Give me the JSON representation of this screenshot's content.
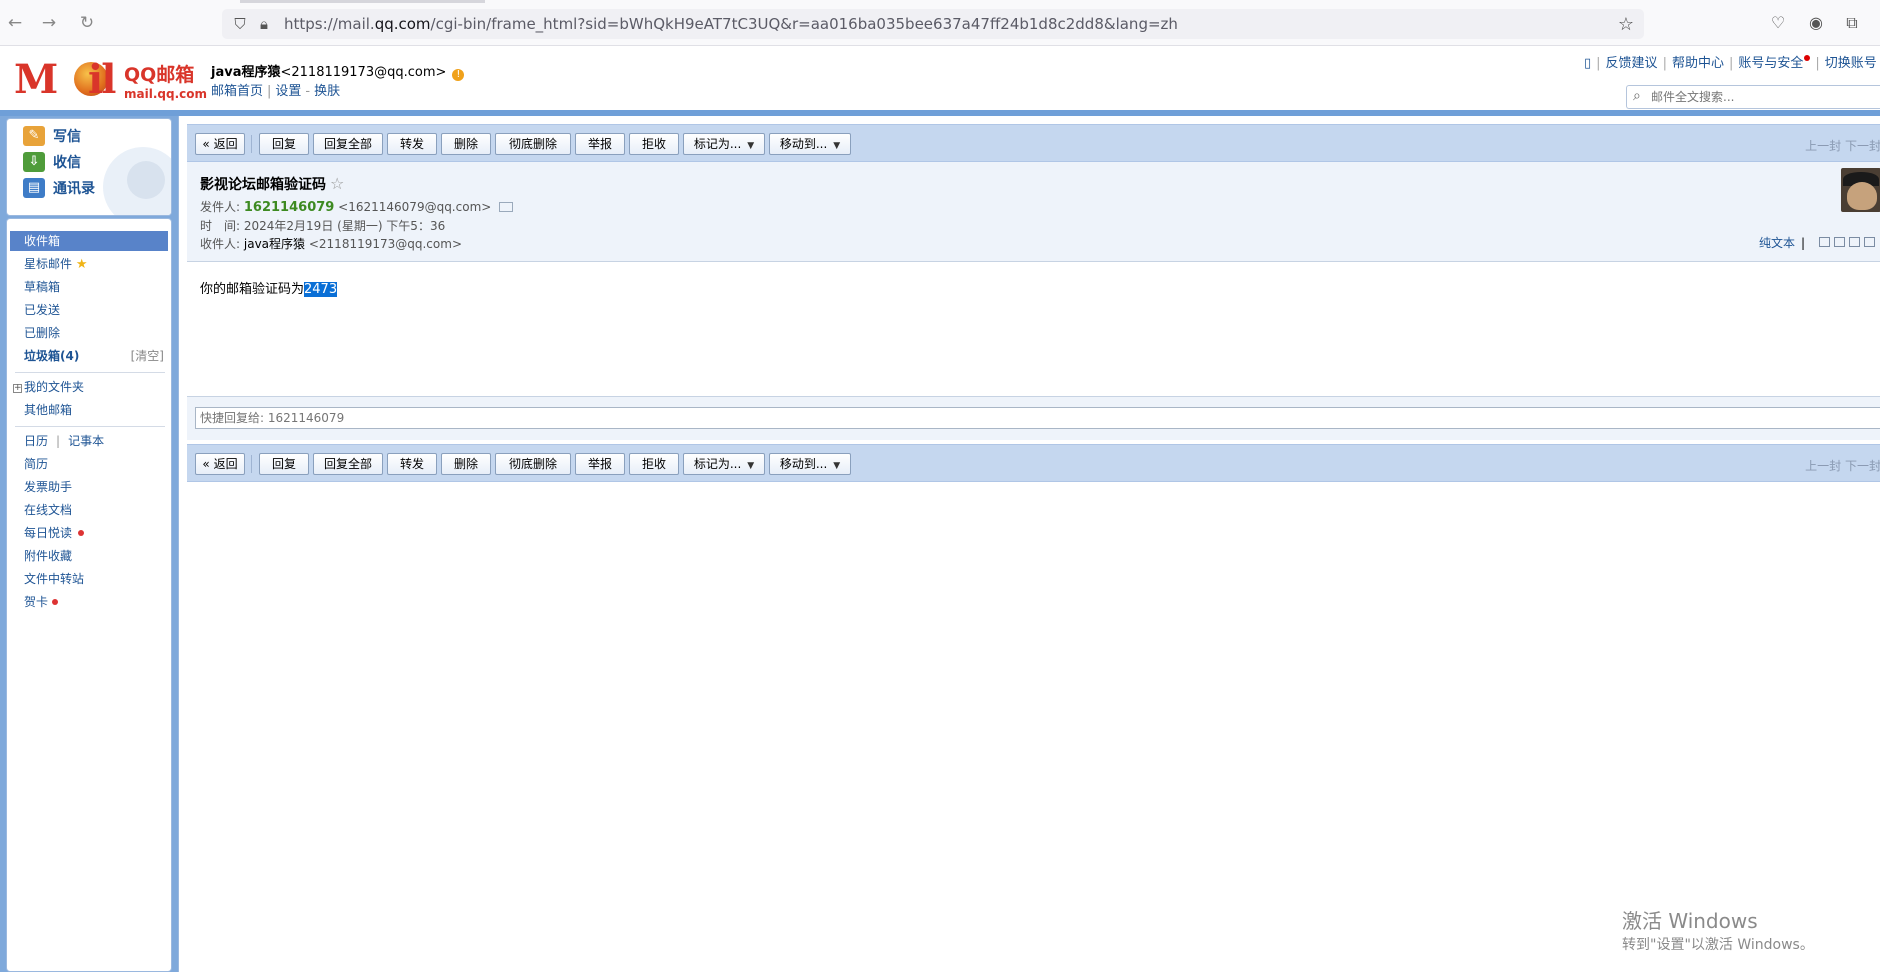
{
  "browser": {
    "url_prefix": "https://mail.",
    "url_domain": "qq.com",
    "url_rest": "/cgi-bin/frame_html?sid=bWhQkH9eAT7tC3UQ&r=aa016ba035bee637a47ff24b1d8c2dd8&lang=zh"
  },
  "header": {
    "logo_m": "M",
    "logo_il": "il",
    "logo_brand": "QQ邮箱",
    "logo_domain": "mail.qq.com",
    "user_name": "java程序猿",
    "user_email": "<2118119173@qq.com>",
    "warn": "!",
    "links": [
      "邮箱首页",
      "设置",
      "换肤"
    ],
    "link_sep1": "|",
    "link_sep2": "-",
    "top_links": [
      "反馈建议",
      "帮助中心",
      "账号与安全",
      "切换账号"
    ],
    "search_placeholder": "邮件全文搜索..."
  },
  "sidebar": {
    "actions": [
      "写信",
      "收信",
      "通讯录"
    ],
    "folders": {
      "inbox": "收件箱",
      "starred": "星标邮件",
      "drafts": "草稿箱",
      "sent": "已发送",
      "deleted": "已删除",
      "spam": "垃圾箱(4)",
      "spam_clear": "[清空]",
      "my_folders": "我的文件夹",
      "other_mail": "其他邮箱"
    },
    "apps": {
      "calendar": "日历",
      "notes": "记事本",
      "resume": "简历",
      "invoice": "发票助手",
      "docs": "在线文档",
      "reading": "每日悦读",
      "attachments": "附件收藏",
      "transfer": "文件中转站",
      "cards": "贺卡"
    }
  },
  "toolbar": {
    "back": "« 返回",
    "reply": "回复",
    "reply_all": "回复全部",
    "forward": "转发",
    "delete": "删除",
    "delete_perm": "彻底删除",
    "report": "举报",
    "reject": "拒收",
    "mark_as": "标记为...",
    "move_to": "移动到...",
    "nav": "上一封 下一封"
  },
  "mail": {
    "subject": "影视论坛邮箱验证码",
    "from_label": "发件人:",
    "from_name": "1621146079",
    "from_email": "<1621146079@qq.com>",
    "time_label": "时　间:",
    "time_value": "2024年2月19日 (星期一) 下午5：36",
    "to_label": "收件人:",
    "to_name": "java程序猿",
    "to_email": "<2118119173@qq.com>",
    "plain_text": "纯文本",
    "body_prefix": "你的邮箱验证码为",
    "body_code": "2473",
    "quick_reply_placeholder": "快捷回复给: 1621146079"
  },
  "watermark": {
    "line1": "激活 Windows",
    "line2": "转到\"设置\"以激活 Windows。"
  }
}
